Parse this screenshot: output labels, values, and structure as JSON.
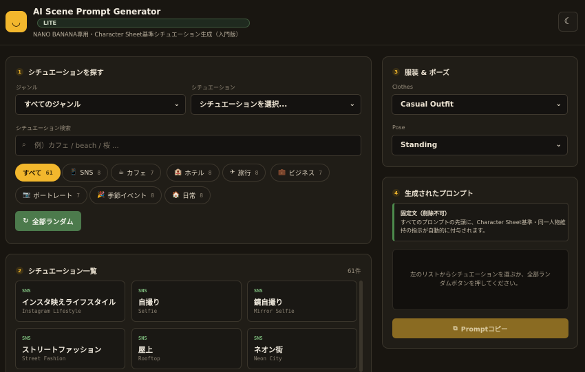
{
  "header": {
    "logo_glyph": "◡",
    "title": "AI Scene Prompt Generator",
    "badge": "LITE",
    "subtitle": "NANO BANANA専用・Character Sheet基準シチュエーション生成（入門版）",
    "theme_icon": "☾"
  },
  "step1": {
    "num": "1",
    "title": "シチュエーションを探す",
    "genre_label": "ジャンル",
    "genre_value": "すべてのジャンル",
    "situation_label": "シチュエーション",
    "situation_value": "シチュエーションを選択...",
    "search_label": "シチュエーション検索",
    "search_placeholder": "例）カフェ / beach / 桜 ...",
    "chips": [
      {
        "icon": "",
        "label": "すべて",
        "count": "61"
      },
      {
        "icon": "📱",
        "label": "SNS",
        "count": "8"
      },
      {
        "icon": "☕",
        "label": "カフェ",
        "count": "7"
      },
      {
        "icon": "🏨",
        "label": "ホテル",
        "count": "8"
      },
      {
        "icon": "✈",
        "label": "旅行",
        "count": "8"
      },
      {
        "icon": "💼",
        "label": "ビジネス",
        "count": "7"
      },
      {
        "icon": "📷",
        "label": "ポートレート",
        "count": "7"
      },
      {
        "icon": "🎉",
        "label": "季節イベント",
        "count": "8"
      },
      {
        "icon": "🏠",
        "label": "日常",
        "count": "8"
      }
    ],
    "random_label": "全部ランダム",
    "random_icon": "↻"
  },
  "step2": {
    "num": "2",
    "title": "シチュエーション一覧",
    "count": "61件",
    "cards": [
      {
        "cat": "SNS",
        "name": "インスタ映えライフスタイル",
        "en": "Instagram Lifestyle"
      },
      {
        "cat": "SNS",
        "name": "自撮り",
        "en": "Selfie"
      },
      {
        "cat": "SNS",
        "name": "鏡自撮り",
        "en": "Mirror Selfie"
      },
      {
        "cat": "SNS",
        "name": "ストリートファッション",
        "en": "Street Fashion"
      },
      {
        "cat": "SNS",
        "name": "屋上",
        "en": "Rooftop"
      },
      {
        "cat": "SNS",
        "name": "ネオン街",
        "en": "Neon City"
      }
    ]
  },
  "step3": {
    "num": "3",
    "title": "服装 & ポーズ",
    "clothes_label": "Clothes",
    "clothes_value": "Casual Outfit",
    "pose_label": "Pose",
    "pose_value": "Standing"
  },
  "step4": {
    "num": "4",
    "title": "生成されたプロンプト",
    "fixed_title": "固定文（削除不可）",
    "fixed_desc": "すべてのプロンプトの先頭に、Character Sheet基準・同一人物維持の指示が自動的に付与されます。",
    "output_placeholder": "左のリストからシチュエーションを選ぶか、全部ランダムボタンを押してください。",
    "copy_label": "Promptコピー",
    "copy_icon": "⧉"
  },
  "colors": {
    "accent": "#f2b72d",
    "green": "#4c7a4c",
    "background": "#181510",
    "panel": "#201d17"
  }
}
